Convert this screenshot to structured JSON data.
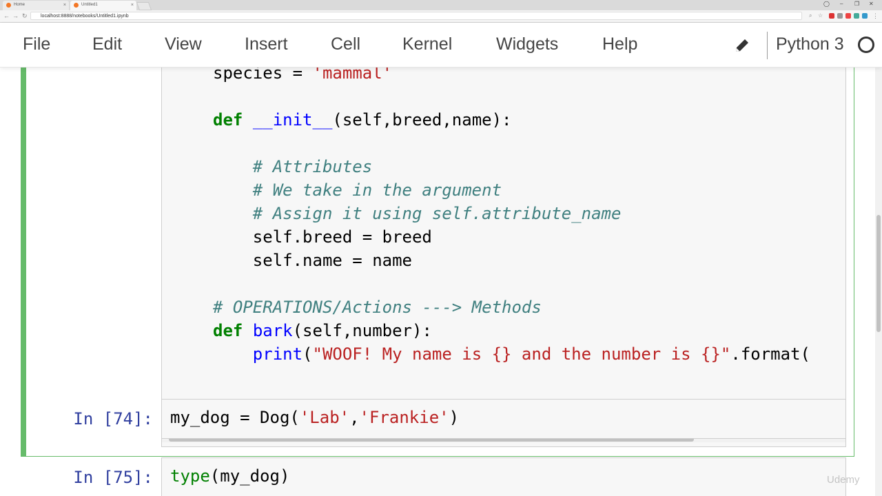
{
  "browser": {
    "tabs": [
      {
        "label": "Home",
        "active": false
      },
      {
        "label": "Untitled1",
        "active": true
      }
    ],
    "url": "localhost:8888/notebooks/Untitled1.ipynb"
  },
  "menubar": {
    "items": [
      "File",
      "Edit",
      "View",
      "Insert",
      "Cell",
      "Kernel",
      "Widgets",
      "Help"
    ],
    "kernel_name": "Python 3",
    "edit_icon": "pencil-icon",
    "kernel_status_icon": "kernel-idle-circle-icon"
  },
  "cells": [
    {
      "selected": true,
      "lines": {
        "l1": {
          "var": "species",
          "op": " = ",
          "str": "'mammal'"
        },
        "l2": {
          "kw": "def",
          "fn": "__init__",
          "rest": "(self,breed,name):"
        },
        "l3": "# Attributes",
        "l4": "# We take in the argument",
        "l5": "# Assign it using self.attribute_name",
        "l6": "self.breed = breed",
        "l7": "self.name = name",
        "l8": "# OPERATIONS/Actions ---> Methods",
        "l9": {
          "kw": "def",
          "fn": "bark",
          "rest": "(self,number):"
        },
        "l10": {
          "fn": "print",
          "open": "(",
          "str": "\"WOOF! My name is {} and the number is {}\"",
          "rest": ".format("
        }
      }
    },
    {
      "prompt": "In [74]:",
      "code": {
        "pre": "my_dog = Dog(",
        "s1": "'Lab'",
        "comma": ",",
        "s2": "'Frankie'",
        "post": ")"
      }
    },
    {
      "prompt": "In [75]:",
      "code": {
        "builtin": "type",
        "rest": "(my_dog)"
      }
    }
  ],
  "colors": {
    "selected_border": "#66bb6a",
    "prompt": "#303f9f",
    "keyword": "#008000",
    "string": "#ba2121",
    "comment": "#408080"
  },
  "watermark": "Udemy"
}
